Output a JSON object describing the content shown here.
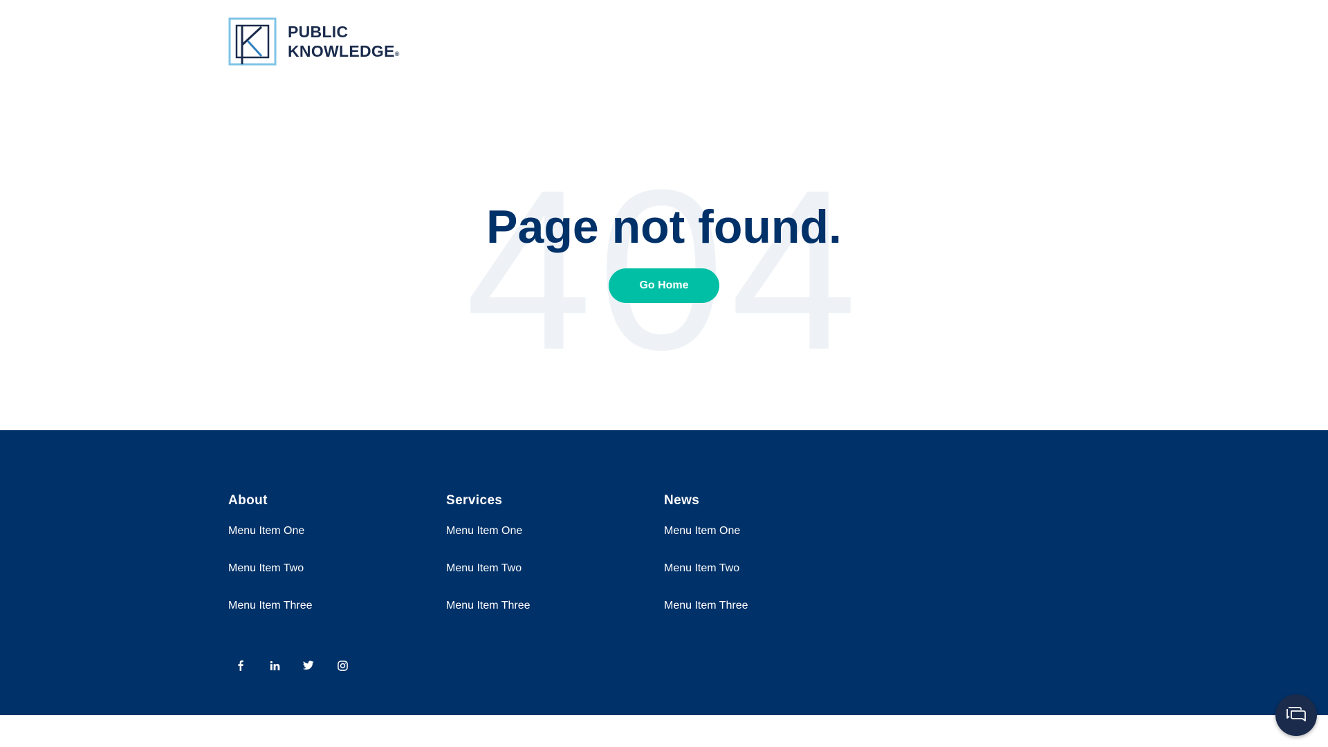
{
  "brand": {
    "line1": "PUBLIC",
    "line2": "KNOWLEDGE",
    "registered": "®",
    "primary_color": "#003168",
    "accent_color": "#00bfa5",
    "logo_frame_color": "#7fc4e6"
  },
  "hero": {
    "background_text": "404",
    "title": "Page not found.",
    "button_label": "Go Home"
  },
  "footer": {
    "columns": [
      {
        "heading": "About",
        "items": [
          "Menu Item One",
          "Menu Item Two",
          "Menu Item Three"
        ]
      },
      {
        "heading": "Services",
        "items": [
          "Menu Item One",
          "Menu Item Two",
          "Menu Item Three"
        ]
      },
      {
        "heading": "News",
        "items": [
          "Menu Item One",
          "Menu Item Two",
          "Menu Item Three"
        ]
      }
    ],
    "social": [
      {
        "icon": "facebook-icon"
      },
      {
        "icon": "linkedin-icon"
      },
      {
        "icon": "twitter-icon"
      },
      {
        "icon": "instagram-icon"
      }
    ]
  },
  "chat": {
    "icon": "chat-icon"
  }
}
